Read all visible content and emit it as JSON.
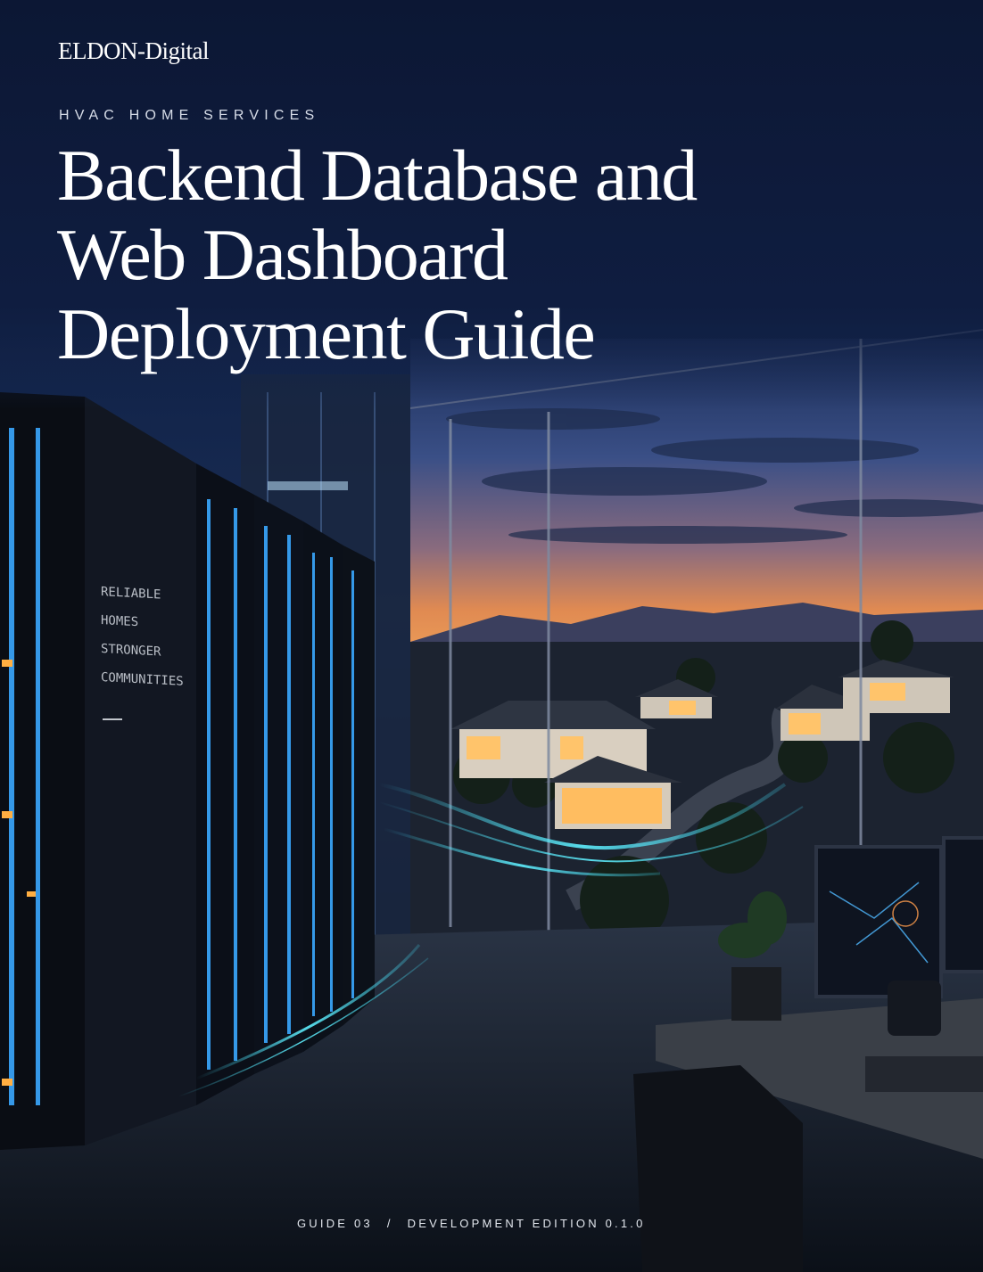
{
  "brand": {
    "name": "ELDON-Digital"
  },
  "cover": {
    "eyebrow": "HVAC HOME SERVICES",
    "title_lines": [
      "Backend Database and",
      "Web Dashboard",
      "Deployment Guide"
    ]
  },
  "photo_wall": {
    "lines": [
      "RELIABLE",
      "HOMES",
      "STRONGER",
      "COMMUNITIES"
    ]
  },
  "footer": {
    "guide": "GUIDE 03",
    "separator": "/",
    "edition": "DEVELOPMENT EDITION 0.1.0"
  }
}
